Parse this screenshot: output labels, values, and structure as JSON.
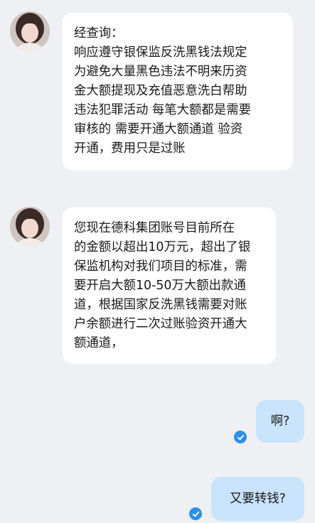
{
  "chat": {
    "messages": [
      {
        "side": "incoming",
        "avatar_icon": "user-avatar-icon",
        "lines": [
          "经查询：",
          "响应遵守银保监反洗黑钱法规定",
          "为避免大量黑色违法不明来历资",
          "金大额提现及充值恶意洗白帮助",
          "违法犯罪活动 每笔大额都是需要",
          "审核的 需要开通大额通道 验资",
          "开通，费用只是过账"
        ]
      },
      {
        "side": "incoming",
        "avatar_icon": "user-avatar-icon",
        "lines": [
          "您现在德科集团账号目前所在",
          "的金额以超出10万元，超出了银",
          "保监机构对我们项目的标准，需",
          "要开启大额10-50万大额出款通",
          "道，根据国家反洗黑钱需要对账",
          "户余额进行二次过账验资开通大",
          "额通道，"
        ]
      },
      {
        "side": "outgoing",
        "text": "啊?",
        "status_icon": "read-check-icon"
      },
      {
        "side": "outgoing",
        "text": "又要转钱?",
        "status_icon": "read-check-icon"
      }
    ]
  },
  "colors": {
    "background": "#eef0f3",
    "incoming_bubble": "#ffffff",
    "outgoing_bubble": "#c9e3fb",
    "read_check": "#2f8fe6"
  }
}
